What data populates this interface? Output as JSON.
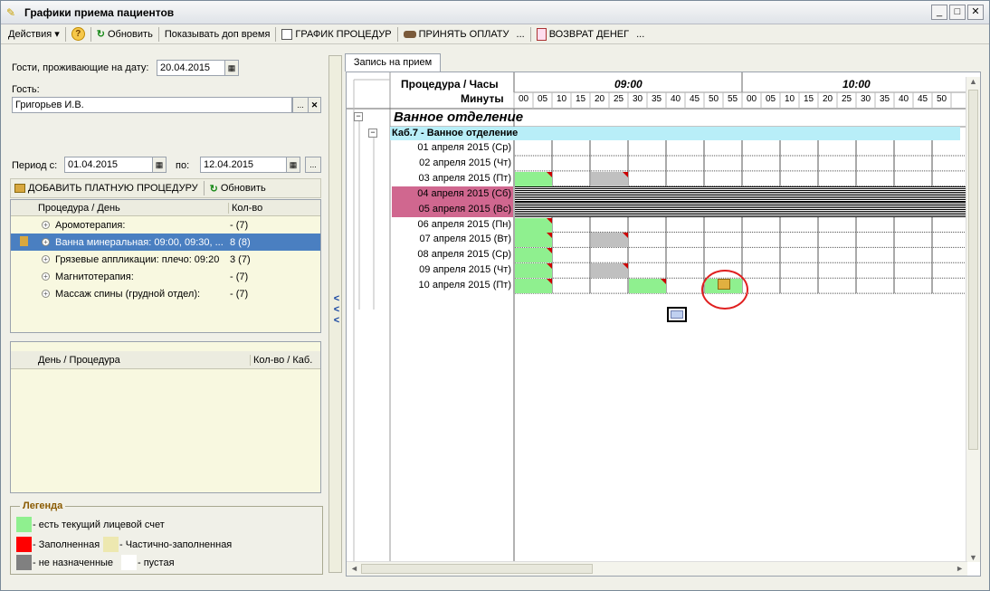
{
  "window": {
    "title": "Графики приема пациентов",
    "min": "_",
    "max": "□",
    "close": "✕"
  },
  "toolbar": {
    "actions": "Действия ▾",
    "help": "?",
    "refresh": "Обновить",
    "show_extra": "Показывать доп время",
    "schedule": "ГРАФИК ПРОЦЕДУР",
    "accept_payment": "ПРИНЯТЬ ОПЛАТУ",
    "more1": "...",
    "refund": "ВОЗВРАТ ДЕНЕГ",
    "more2": "..."
  },
  "left": {
    "guests_label": "Гости, проживающие на дату:",
    "guests_date": "20.04.2015",
    "guest_label": "Гость:",
    "guest_value": "Григорьев И.В.",
    "guest_dots": "...",
    "guest_clear": "✕",
    "period_label": "Период с:",
    "period_from": "01.04.2015",
    "period_to_label": "по:",
    "period_to": "12.04.2015",
    "period_dots": "...",
    "add_paid": "ДОБАВИТЬ ПЛАТНУЮ ПРОЦЕДУРУ",
    "refresh2": "Обновить",
    "proc_col1": "Процедура / День",
    "proc_col2": "Кол-во",
    "procedures": [
      {
        "name": "Аромотерапия:",
        "count": "- (7)"
      },
      {
        "name": "Ванна минеральная: 09:00, 09:30, ...",
        "count": "8 (8)"
      },
      {
        "name": "Грязевые аппликации: плечо: 09:20",
        "count": "3 (7)"
      },
      {
        "name": "Магнитотерапия:",
        "count": "- (7)"
      },
      {
        "name": "Массаж спины (грудной отдел):",
        "count": "- (7)"
      }
    ],
    "day_col1": "День / Процедура",
    "day_col2": "Кол-во / Каб.",
    "legend_title": "Легенда",
    "legend": {
      "current_account": "- есть текущий лицевой счет",
      "filled": "- Заполненная",
      "partial": "- Частично-заполненная",
      "not_assigned": "- не назначенные",
      "empty": "- пустая"
    }
  },
  "splitter": {
    "arrows": "<\n<\n<"
  },
  "schedule": {
    "tab": "Запись на прием",
    "hdr_proc_hours": "Процедура / Часы",
    "hdr_minutes": "Минуты",
    "hours": [
      "09:00",
      "10:00"
    ],
    "minutes": [
      "00",
      "05",
      "10",
      "15",
      "20",
      "25",
      "30",
      "35",
      "40",
      "45",
      "50",
      "55",
      "00",
      "05",
      "10",
      "15",
      "20",
      "25",
      "30",
      "35",
      "40",
      "45",
      "50"
    ],
    "department": "Ванное отделение",
    "cabinet": "Каб.7 - Ванное отделение",
    "days": [
      {
        "label": "01 апреля 2015  (Ср)",
        "weekend": false
      },
      {
        "label": "02 апреля 2015  (Чт)",
        "weekend": false
      },
      {
        "label": "03 апреля 2015  (Пт)",
        "weekend": false
      },
      {
        "label": "04 апреля 2015  (Сб)",
        "weekend": true
      },
      {
        "label": "05 апреля 2015  (Вс)",
        "weekend": true
      },
      {
        "label": "06 апреля 2015  (Пн)",
        "weekend": false
      },
      {
        "label": "07 апреля 2015  (Вт)",
        "weekend": false
      },
      {
        "label": "08 апреля 2015  (Ср)",
        "weekend": false
      },
      {
        "label": "09 апреля 2015  (Чт)",
        "weekend": false
      },
      {
        "label": "10 апреля 2015  (Пт)",
        "weekend": false
      }
    ],
    "colors": {
      "green": "#8ff08f",
      "gray": "#c0c0c0",
      "weekend": "#d0678f",
      "cabinet": "#b8eef8"
    }
  }
}
